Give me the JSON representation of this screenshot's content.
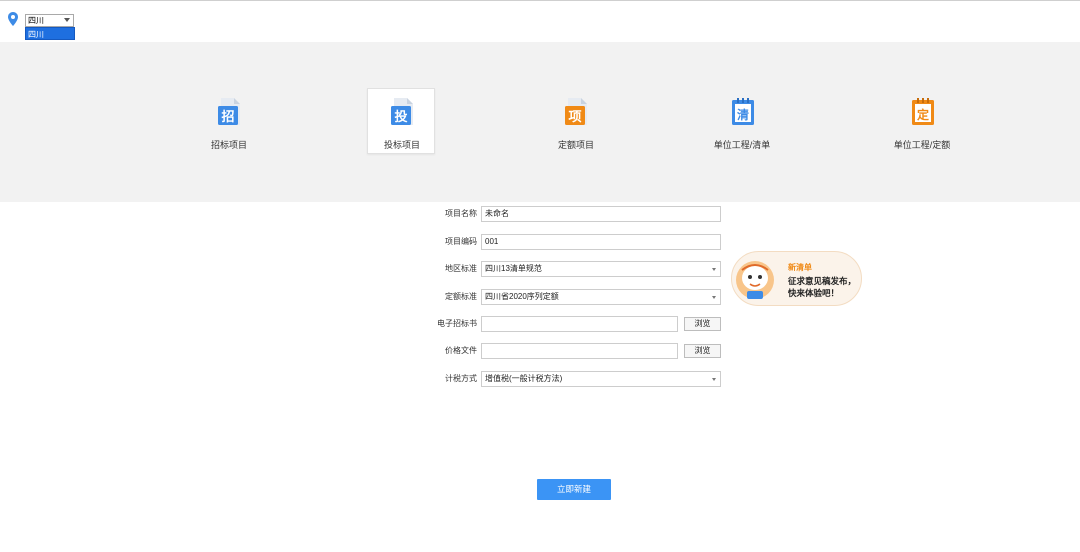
{
  "region": {
    "selected": "四川",
    "dropdown_option": "四川",
    "icon": "location-pin-icon"
  },
  "project_types": [
    {
      "label": "招标项目",
      "glyph": "招",
      "color": "#3d8be6",
      "icon": "tender-document-icon",
      "active": false
    },
    {
      "label": "投标项目",
      "glyph": "投",
      "color": "#3d8be6",
      "icon": "bid-document-icon",
      "active": true
    },
    {
      "label": "定额项目",
      "glyph": "项",
      "color": "#f08a16",
      "icon": "quota-document-icon",
      "active": false
    },
    {
      "label": "单位工程/清单",
      "glyph": "清",
      "color": "#3d8be6",
      "icon": "bill-notebook-icon",
      "active": false
    },
    {
      "label": "单位工程/定额",
      "glyph": "定",
      "color": "#f08a16",
      "icon": "quota-notebook-icon",
      "active": false
    }
  ],
  "form": {
    "project_name_label": "项目名称",
    "project_name_value": "未命名",
    "project_code_label": "项目编码",
    "project_code_value": "001",
    "region_standard_label": "地区标准",
    "region_standard_value": "四川13清单规范",
    "quota_standard_label": "定额标准",
    "quota_standard_value": "四川省2020序列定额",
    "e_bid_label": "电子招标书",
    "e_bid_value": "",
    "price_file_label": "价格文件",
    "price_file_value": "",
    "browse_label": "浏览",
    "tax_method_label": "计税方式",
    "tax_method_value": "增值税(一般计税方法)"
  },
  "promo": {
    "title": "新清单",
    "line1": "征求意见稿发布，",
    "line2": "快来体验吧！"
  },
  "create_button": "立即新建",
  "colors": {
    "accent_blue": "#3b94f5",
    "selection_blue": "#1e6fe0",
    "orange": "#f08a16",
    "banner_bg": "#f2f2f2"
  }
}
